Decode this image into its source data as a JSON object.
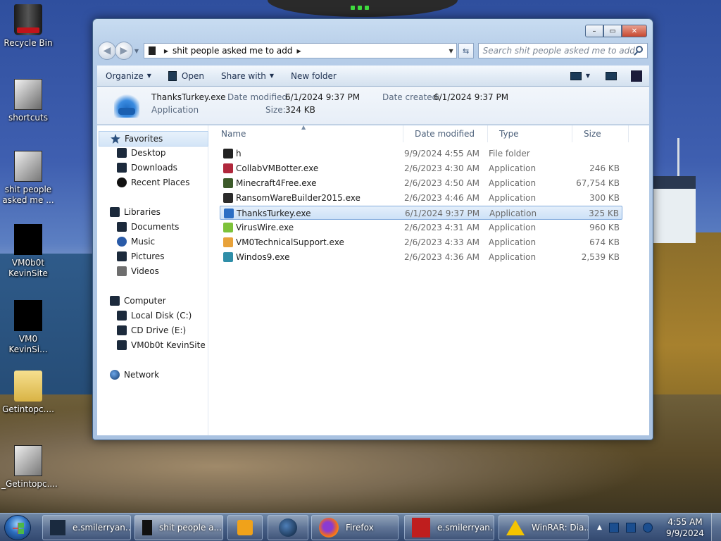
{
  "desktop": {
    "icons": [
      {
        "label": "Recycle Bin"
      },
      {
        "label": "shortcuts"
      },
      {
        "label": "shit people asked me ..."
      },
      {
        "label": "VM0b0t KevinSite"
      },
      {
        "label": "VM0 KevinSi..."
      },
      {
        "label": "Getintopc...."
      },
      {
        "label": "_Getintopc...."
      }
    ]
  },
  "window": {
    "controls": {
      "minimize": "–",
      "maximize": "▭",
      "close": "✕"
    },
    "address": {
      "path_segment": "shit people asked me to add"
    },
    "search": {
      "placeholder": "Search shit people asked me to add"
    },
    "toolbar": {
      "organize": "Organize",
      "open": "Open",
      "share_with": "Share with",
      "new_folder": "New folder"
    },
    "details": {
      "name": "ThanksTurkey.exe",
      "type": "Application",
      "date_modified_label": "Date modified:",
      "date_modified": "6/1/2024 9:37 PM",
      "size_label": "Size:",
      "size": "324 KB",
      "date_created_label": "Date created:",
      "date_created": "6/1/2024 9:37 PM"
    },
    "nav": {
      "favorites": "Favorites",
      "desktop": "Desktop",
      "downloads": "Downloads",
      "recent_places": "Recent Places",
      "libraries": "Libraries",
      "documents": "Documents",
      "music": "Music",
      "pictures": "Pictures",
      "videos": "Videos",
      "computer": "Computer",
      "local_disk": "Local Disk (C:)",
      "cd_drive": "CD Drive (E:)",
      "vm_drive": "VM0b0t KevinSite",
      "network": "Network"
    },
    "columns": {
      "name": "Name",
      "date_modified": "Date modified",
      "type": "Type",
      "size": "Size"
    },
    "files": [
      {
        "name": "h",
        "date": "9/9/2024 4:55 AM",
        "type": "File folder",
        "size": "",
        "icon_color": "#222222"
      },
      {
        "name": "CollabVMBotter.exe",
        "date": "2/6/2023 4:30 AM",
        "type": "Application",
        "size": "246 KB",
        "icon_color": "#b0283c"
      },
      {
        "name": "Minecraft4Free.exe",
        "date": "2/6/2023 4:50 AM",
        "type": "Application",
        "size": "67,754 KB",
        "icon_color": "#3c5a2a"
      },
      {
        "name": "RansomWareBuilder2015.exe",
        "date": "2/6/2023 4:46 AM",
        "type": "Application",
        "size": "300 KB",
        "icon_color": "#2b2b2b"
      },
      {
        "name": "ThanksTurkey.exe",
        "date": "6/1/2024 9:37 PM",
        "type": "Application",
        "size": "325 KB",
        "icon_color": "#2b6ec4",
        "selected": true
      },
      {
        "name": "VirusWire.exe",
        "date": "2/6/2023 4:31 AM",
        "type": "Application",
        "size": "960 KB",
        "icon_color": "#7dc23a"
      },
      {
        "name": "VM0TechnicalSupport.exe",
        "date": "2/6/2023 4:33 AM",
        "type": "Application",
        "size": "674 KB",
        "icon_color": "#e8a23a"
      },
      {
        "name": "Windos9.exe",
        "date": "2/6/2023 4:36 AM",
        "type": "Application",
        "size": "2,539 KB",
        "icon_color": "#2f8ea8"
      }
    ]
  },
  "taskbar": {
    "buttons": [
      {
        "label": "e.smilerryan...."
      },
      {
        "label": "shit people a..."
      },
      {
        "label": "Firefox"
      },
      {
        "label": "e.smilerryan...."
      },
      {
        "label": "WinRAR: Dia..."
      }
    ],
    "clock": {
      "time": "4:55 AM",
      "date": "9/9/2024"
    }
  }
}
